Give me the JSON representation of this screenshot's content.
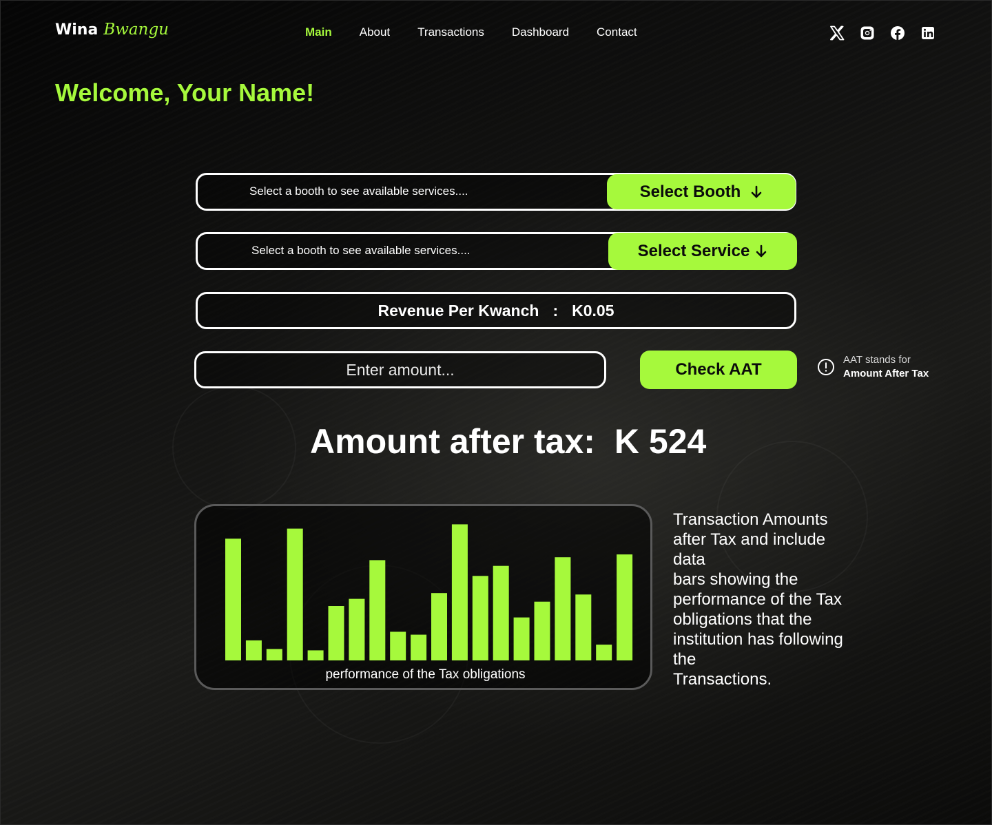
{
  "brand": {
    "name": "Wina",
    "accent": "Bwangu",
    "accent_color": "#a6f93c"
  },
  "nav": {
    "items": [
      {
        "label": "Main",
        "active": true
      },
      {
        "label": "About",
        "active": false
      },
      {
        "label": "Transactions",
        "active": false
      },
      {
        "label": "Dashboard",
        "active": false
      },
      {
        "label": "Contact",
        "active": false
      }
    ]
  },
  "socials": [
    "x-icon",
    "instagram-icon",
    "facebook-icon",
    "linkedin-icon"
  ],
  "welcome": "Welcome, Your Name!",
  "booth": {
    "placeholder": "Select a booth to see available services....",
    "button_label": "Select Booth"
  },
  "service": {
    "placeholder": "Select a booth to see available services....",
    "button_label": "Select Service"
  },
  "revenue": {
    "label": "Revenue Per Kwanch",
    "separator": ":",
    "value": "K0.05"
  },
  "amount_input": {
    "placeholder": "Enter amount..."
  },
  "check_button": "Check AAT",
  "info": {
    "line1": "AAT stands for",
    "line2": "Amount After Tax"
  },
  "result": {
    "label": "Amount after tax:",
    "value": "K 524"
  },
  "chart_data": {
    "type": "bar",
    "title": "",
    "xlabel": "performance of the Tax obligations",
    "ylabel": "",
    "values": [
      85,
      14,
      8,
      92,
      7,
      38,
      43,
      70,
      20,
      18,
      47,
      95,
      59,
      66,
      30,
      41,
      72,
      46,
      11,
      74
    ],
    "ylim": [
      0,
      100
    ],
    "bar_color": "#a6f93c"
  },
  "description": {
    "lines": [
      "Transaction Amounts",
      "after Tax and include",
      "data",
      "bars showing the",
      "performance of the Tax",
      "obligations that the",
      "institution has following",
      "the",
      "Transactions."
    ]
  }
}
